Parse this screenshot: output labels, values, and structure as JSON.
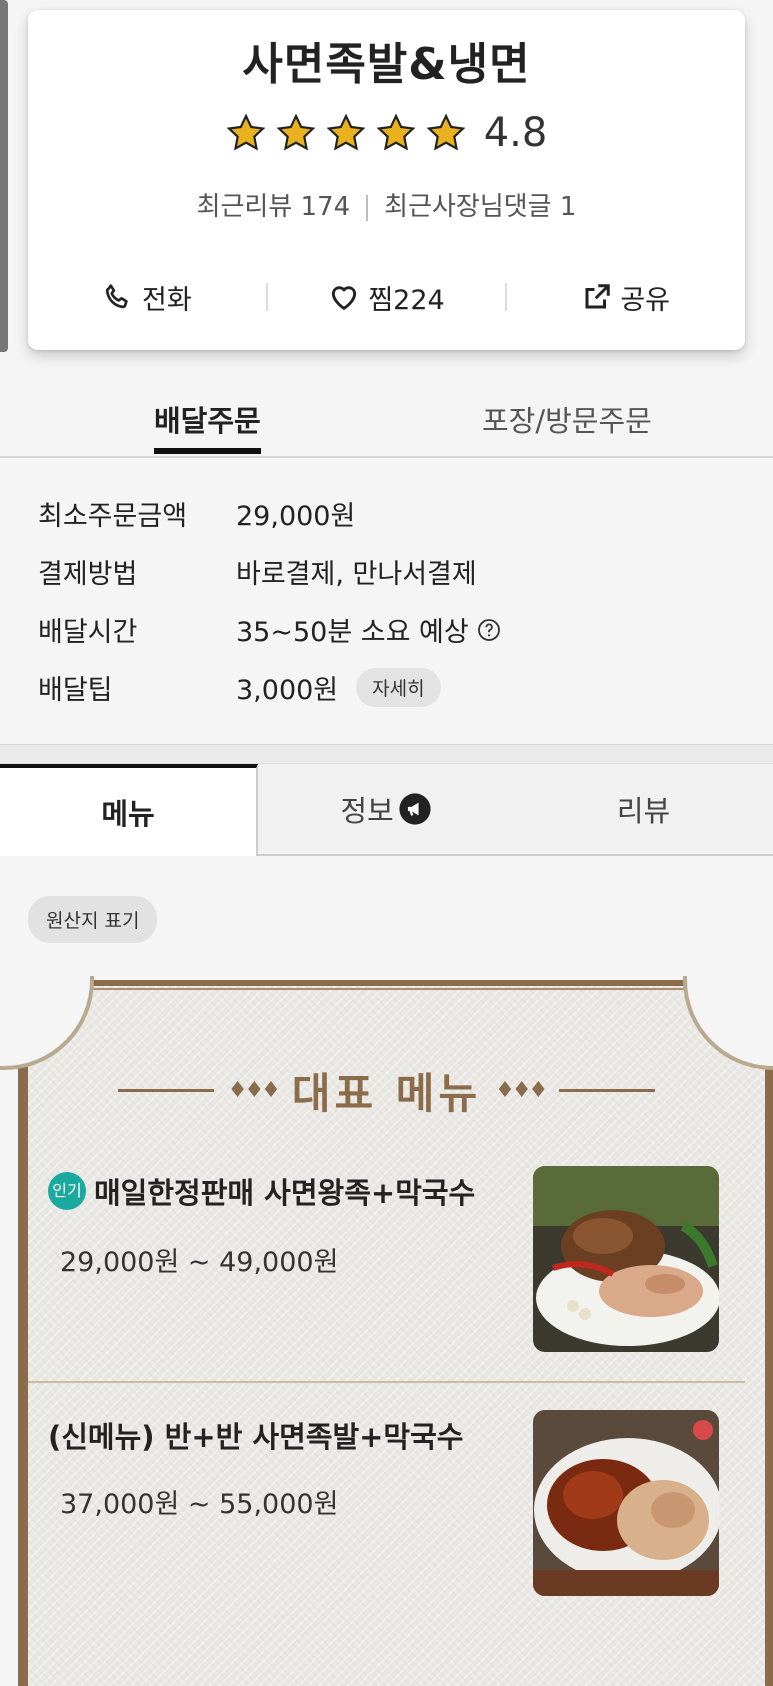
{
  "store": {
    "name": "사면족발&냉면",
    "rating": "4.8",
    "stars": 5,
    "recent_reviews": "최근리뷰 174",
    "owner_replies": "최근사장님댓글 1"
  },
  "actions": {
    "call": "전화",
    "favorite": "찜224",
    "share": "공유"
  },
  "order_tabs": {
    "delivery": "배달주문",
    "pickup": "포장/방문주문"
  },
  "delivery_info": [
    {
      "label": "최소주문금액",
      "value": "29,000원"
    },
    {
      "label": "결제방법",
      "value": "바로결제, 만나서결제"
    },
    {
      "label": "배달시간",
      "value": "35~50분 소요 예상"
    },
    {
      "label": "배달팁",
      "value": "3,000원",
      "button": "자세히"
    }
  ],
  "main_tabs": {
    "menu": "메뉴",
    "info": "정보",
    "review": "리뷰"
  },
  "origin_button": "원산지 표기",
  "featured": {
    "title": "대표 메뉴",
    "items": [
      {
        "badge": "인기",
        "name": "매일한정판매 사면왕족+막국수",
        "price": "29,000원 ~ 49,000원"
      },
      {
        "name": "(신메뉴) 반+반 사면족발+막국수",
        "price": "37,000원 ~ 55,000원"
      }
    ]
  },
  "colors": {
    "accent_brown": "#8a6b4a",
    "badge_teal": "#1aa9a0",
    "star_gold": "#e9b020"
  }
}
